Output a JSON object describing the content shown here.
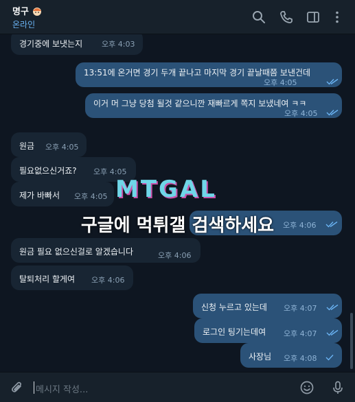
{
  "header": {
    "peer_name": "명구",
    "peer_status": "온라인"
  },
  "messages": [
    {
      "dir": "in",
      "text": "경기중에 보냇는지",
      "time": "오후 4:03"
    },
    {
      "dir": "out",
      "text": "13:51에 온거면 경기 두개 끝나고 마지막 경기 끝날때쯤 보낸건데",
      "time": "오후 4:05",
      "read": true
    },
    {
      "dir": "out",
      "text": "이거 머 그냥 당첨 될것 같으니깐 재빠르게 쪽지 보냈네여 ㅋㅋ",
      "time": "오후 4:05",
      "read": true
    },
    {
      "dir": "in",
      "text": "원금",
      "time": "오후 4:05"
    },
    {
      "dir": "in",
      "text": "필요없으신거죠?",
      "time": "오후 4:05"
    },
    {
      "dir": "in",
      "text": "제가 바빠서",
      "time": "오후 4:05"
    },
    {
      "dir": "out",
      "text": "",
      "time": "오후 4:06",
      "read": true
    },
    {
      "dir": "in",
      "text": "원금 필요 없으신걸로 알겠습니다",
      "time": "오후 4:06"
    },
    {
      "dir": "in",
      "text": "탈퇴처리 할게여",
      "time": "오후 4:06"
    },
    {
      "dir": "out",
      "text": "신청 누르고 있는데",
      "time": "오후 4:07",
      "read": true
    },
    {
      "dir": "out",
      "text": "로그인 팅기는데여",
      "time": "오후 4:07",
      "read": true
    },
    {
      "dir": "out",
      "text": "사장님",
      "time": "오후 4:08",
      "read": true
    }
  ],
  "watermark": {
    "logo": "MTGAL",
    "text": "구글에 먹튀갤 검색하세요"
  },
  "composer": {
    "placeholder": "메시지 작성..."
  },
  "colors": {
    "background": "#0e1621",
    "header": "#17212b",
    "incoming_bubble": "#182533",
    "outgoing_bubble": "#2b5278",
    "online": "#6ab3f3"
  },
  "icons": [
    "search-icon",
    "phone-icon",
    "sidebar-icon",
    "more-icon",
    "attach-icon",
    "emoji-icon",
    "mic-icon"
  ]
}
